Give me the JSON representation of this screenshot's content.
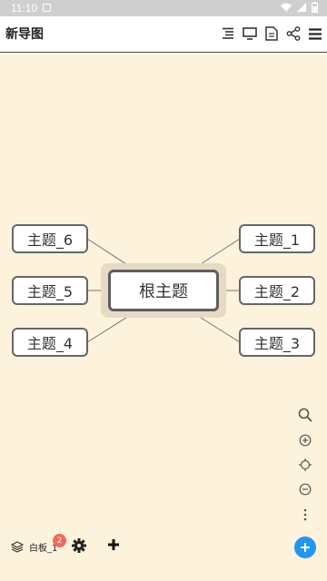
{
  "status_bar": {
    "time": "11:10"
  },
  "app_bar": {
    "title": "新导图",
    "icons": [
      "outline-icon",
      "present-icon",
      "document-icon",
      "share-icon",
      "menu-icon"
    ]
  },
  "mindmap": {
    "root": "根主题",
    "topics": {
      "t1": "主题_1",
      "t2": "主题_2",
      "t3": "主题_3",
      "t4": "主题_4",
      "t5": "主题_5",
      "t6": "主题_6"
    }
  },
  "side_tools": [
    "search-icon",
    "zoom-in-icon",
    "locate-icon",
    "zoom-out-icon",
    "more-icon"
  ],
  "bottom_bar": {
    "board_label": "白板_1",
    "badge_count": "2"
  },
  "colors": {
    "canvas_bg": "#fdf3dc",
    "node_border": "#666666",
    "accent": "#2196f3",
    "badge": "#ef6a5a"
  }
}
